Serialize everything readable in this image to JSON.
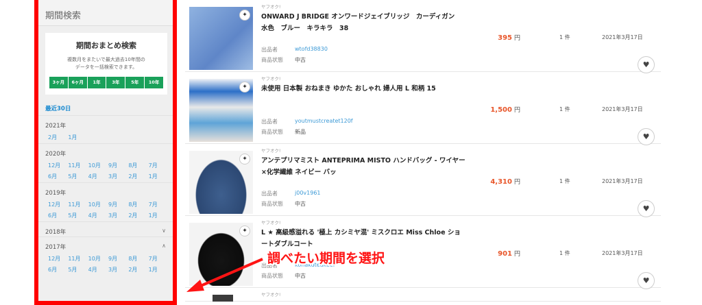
{
  "sidebar": {
    "title": "期間検索",
    "bulk": {
      "title": "期間おまとめ検索",
      "desc_line1": "複数月をまたいで最大過去10年間の",
      "desc_line2": "データを一括検索できます。",
      "buttons": [
        "3ヶ月",
        "6ヶ月",
        "1年",
        "3年",
        "5年",
        "10年"
      ]
    },
    "recent": "最近30日",
    "years": [
      {
        "label": "2021年",
        "months": [
          "2月",
          "1月"
        ]
      },
      {
        "label": "2020年",
        "months": [
          "12月",
          "11月",
          "10月",
          "9月",
          "8月",
          "7月",
          "6月",
          "5月",
          "4月",
          "3月",
          "2月",
          "1月"
        ]
      },
      {
        "label": "2019年",
        "months": [
          "12月",
          "11月",
          "10月",
          "9月",
          "8月",
          "7月",
          "6月",
          "5月",
          "4月",
          "3月",
          "2月",
          "1月"
        ]
      },
      {
        "label": "2018年",
        "chevron": "chevron-down-icon"
      },
      {
        "label": "2017年",
        "chevron": "chevron-up-icon",
        "months": [
          "12月",
          "11月",
          "10月",
          "9月",
          "8月",
          "7月",
          "6月",
          "5月",
          "4月",
          "3月",
          "2月",
          "1月"
        ]
      }
    ]
  },
  "items": [
    {
      "source": "ヤフオク!",
      "title": "ONWARD J BRIDGE オンワードジェイブリッジ　カーディガン　水色　ブルー　キラキラ　38",
      "seller_label": "出品者",
      "seller": "wtofd38830",
      "condition_label": "商品状態",
      "condition": "中古",
      "price": "395",
      "yen": "円",
      "count": "1 件",
      "date": "2021年3月17日"
    },
    {
      "source": "ヤフオク!",
      "title": "未使用 日本製 おねまき ゆかた おしゃれ 婦人用 L 和柄 15",
      "seller_label": "出品者",
      "seller": "youtmustcreatet120f",
      "condition_label": "商品状態",
      "condition": "新品",
      "price": "1,500",
      "yen": "円",
      "count": "1 件",
      "date": "2021年3月17日"
    },
    {
      "source": "ヤフオク!",
      "title": "アンテプリマミスト ANTEPRIMA MISTO ハンドバッグ - ワイヤー×化学繊維 ネイビー バッ",
      "seller_label": "出品者",
      "seller": "j00v1961",
      "condition_label": "商品状態",
      "condition": "中古",
      "price": "4,310",
      "yen": "円",
      "count": "1 件",
      "date": "2021年3月17日"
    },
    {
      "source": "ヤフオク!",
      "title": "L ★ 高級感溢れる '極上 カシミヤ混' ミスクロエ Miss Chloe ショートダブルコート",
      "seller_label": "出品者",
      "seller": "kohakuteakeel",
      "condition_label": "商品状態",
      "condition": "中古",
      "price": "901",
      "yen": "円",
      "count": "1 件",
      "date": "2021年3月17日"
    },
    {
      "source": "ヤフオク!"
    }
  ],
  "annotation": "調べたい期間を選択",
  "icons": {
    "heart": "heart-icon",
    "badge": "auction-badge-icon"
  }
}
